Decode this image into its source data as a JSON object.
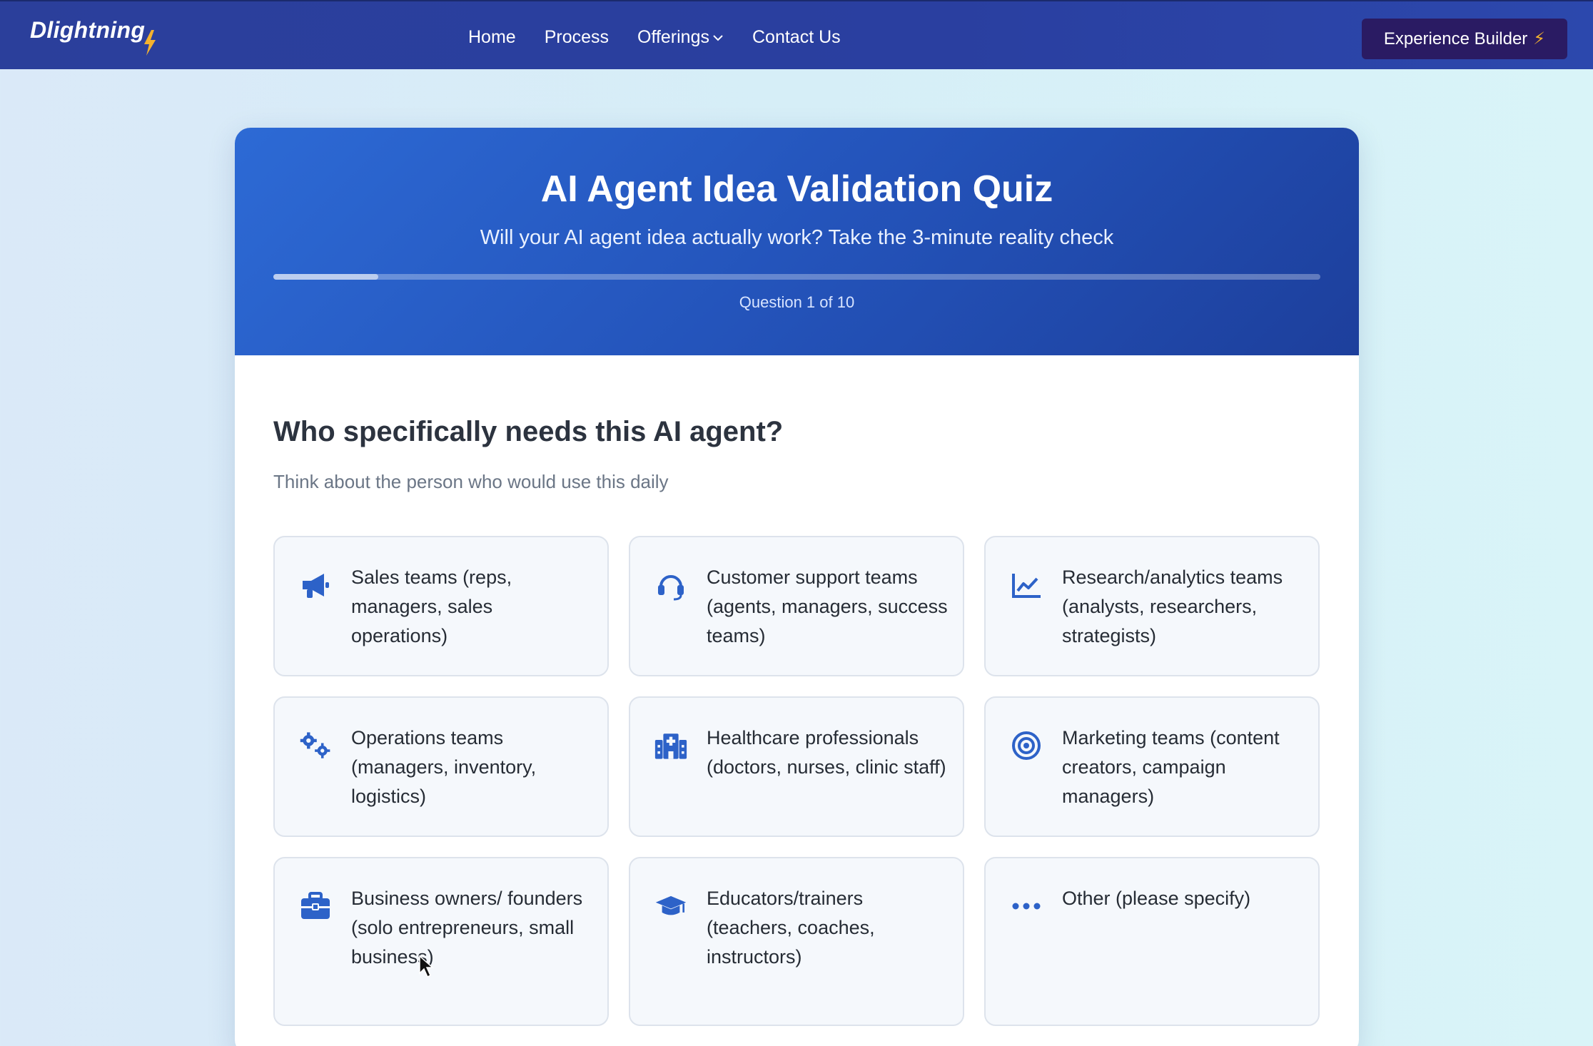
{
  "nav": {
    "logo": "Dlightning",
    "links": [
      {
        "label": "Home"
      },
      {
        "label": "Process"
      },
      {
        "label": "Offerings"
      },
      {
        "label": "Contact Us"
      }
    ],
    "cta": "Experience Builder",
    "cta_icon": "⚡"
  },
  "quiz": {
    "title": "AI Agent Idea Validation Quiz",
    "subtitle": "Will your AI agent idea actually work? Take the 3-minute reality check",
    "progress_text": "Question 1 of 10",
    "progress_fraction": 0.1,
    "question": "Who specifically needs this AI agent?",
    "hint": "Think about the person who would use this daily",
    "options": [
      {
        "label": "Sales teams (reps, managers, sales operations)",
        "icon": "megaphone-icon"
      },
      {
        "label": "Customer support teams (agents, managers, success teams)",
        "icon": "headset-icon"
      },
      {
        "label": "Research/analytics teams (analysts, researchers, strategists)",
        "icon": "chart-line-icon"
      },
      {
        "label": "Operations teams (managers, inventory, logistics)",
        "icon": "gears-icon"
      },
      {
        "label": "Healthcare professionals (doctors, nurses, clinic staff)",
        "icon": "hospital-icon"
      },
      {
        "label": "Marketing teams (content creators, campaign managers)",
        "icon": "target-icon"
      },
      {
        "label": "Business owners/ founders (solo entrepreneurs, small business)",
        "icon": "briefcase-icon"
      },
      {
        "label": "Educators/trainers (teachers, coaches, instructors)",
        "icon": "graduation-cap-icon"
      },
      {
        "label": "Other (please specify)",
        "icon": "ellipsis-icon"
      }
    ]
  },
  "colors": {
    "nav_bg": "#2b3f9b",
    "cta_bg": "#2a1b63",
    "header_bg": "#2454bb",
    "icon": "#2d62c8"
  }
}
